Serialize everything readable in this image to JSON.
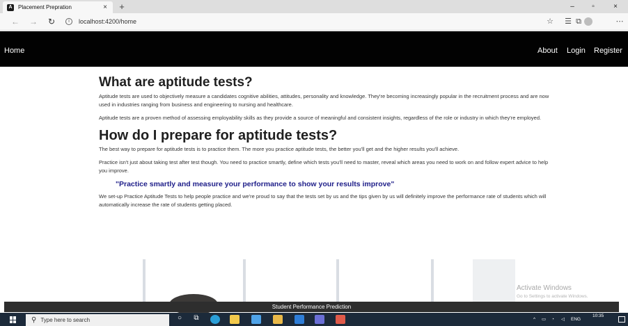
{
  "browser": {
    "tab_title": "Placement Prepration",
    "tab_close": "×",
    "new_tab": "+",
    "favicon": "A",
    "window_controls": {
      "minimize": "–",
      "maximize": "▫",
      "close": "×"
    },
    "url": "localhost:4200/home",
    "icons": {
      "back": "back-arrow-icon",
      "forward": "forward-arrow-icon",
      "refresh": "refresh-icon",
      "info": "info-icon",
      "favorite": "star-icon",
      "favorites_bar": "favorites-list-icon",
      "collections": "collections-icon",
      "profile": "profile-avatar-icon",
      "more": "more-icon"
    }
  },
  "navbar": {
    "brand": "Home",
    "links": [
      "About",
      "Login",
      "Register"
    ],
    "background": "#020202"
  },
  "content": {
    "heading1": "What are aptitude tests?",
    "p1": "Aptitude tests are used to objectively measure a candidates cognitive abilities, attitudes, personality and knowledge. They're becoming increasingly popular in the recruitment process and are now used in industries ranging from business and engineering to nursing and healthcare.",
    "p2": "Aptitude tests are a proven method of assessing employability skills as they provide a source of meaningful and consistent insights, regardless of the role or industry in which they're employed.",
    "heading2": "How do I prepare for aptitude tests?",
    "p3": "The best way to prepare for aptitude tests is to practice them. The more you practice aptitude tests, the better you'll get and the higher results you'll achieve.",
    "p4": "Practice isn't just about taking test after test though. You need to practice smartly, define which tests you'll need to master, reveal which areas you need to work on and follow expert advice to help you improve.",
    "quote": "\"Practice smartly and measure your performance to show your results improve\"",
    "p5": "We set-up Practice Aptitude Tests to help people practice and we're proud to say that the tests set by us and the tips given by us will definitely improve the performance rate of students which will automatically increase the rate of students getting placed.",
    "quote_color": "#20208a"
  },
  "watermark": {
    "title": "Activate Windows",
    "subtitle": "Go to Settings to activate Windows."
  },
  "footer": {
    "text": "Student Performance Prediction"
  },
  "taskbar": {
    "search_placeholder": "Type here to search",
    "tray_lang": "ENG",
    "time": "10:35",
    "date": "",
    "tray_arrow": "^",
    "background": "#1c2a3a"
  }
}
